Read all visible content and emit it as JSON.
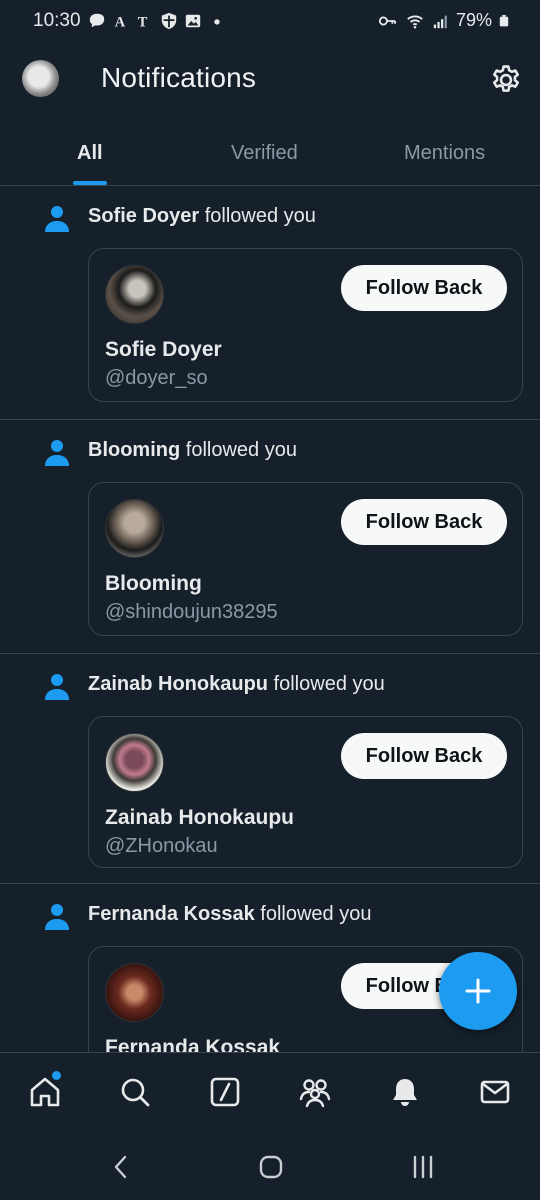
{
  "status_bar": {
    "time": "10:30",
    "battery": "79%",
    "left_icons": [
      "chat-bubble-icon",
      "font-a-icon",
      "nyt-icon",
      "shield-icon",
      "image-icon",
      "dot-icon"
    ],
    "right_icons": [
      "key-icon",
      "wifi-icon",
      "signal-icon",
      "battery-icon"
    ]
  },
  "header": {
    "title": "Notifications",
    "settings_icon": "gear-icon"
  },
  "tabs": [
    {
      "label": "All",
      "active": true
    },
    {
      "label": "Verified",
      "active": false
    },
    {
      "label": "Mentions",
      "active": false
    }
  ],
  "notifications": [
    {
      "name": "Sofie Doyer",
      "action": " followed you",
      "card_name": "Sofie Doyer",
      "handle": "@doyer_so",
      "button": "Follow Back"
    },
    {
      "name": "Blooming",
      "action": " followed you",
      "card_name": "Blooming",
      "handle": "@shindoujun38295",
      "button": "Follow Back"
    },
    {
      "name": "Zainab Honokaupu",
      "action": " followed you",
      "card_name": "Zainab Honokaupu",
      "handle": "@ZHonokau",
      "button": "Follow Back"
    },
    {
      "name": "Fernanda Kossak",
      "action": " followed you",
      "card_name": "Fernanda Kossak",
      "handle": "",
      "button": "Follow Back"
    }
  ],
  "colors": {
    "background": "#15202b",
    "accent": "#1d9bf0",
    "divider": "#38444d",
    "secondary_text": "#8b98a5"
  },
  "bottom_nav": [
    "home-icon",
    "search-icon",
    "grok-icon",
    "communities-icon",
    "bell-icon",
    "mail-icon"
  ],
  "system_nav": [
    "back-icon",
    "home-circle-icon",
    "recents-icon"
  ]
}
